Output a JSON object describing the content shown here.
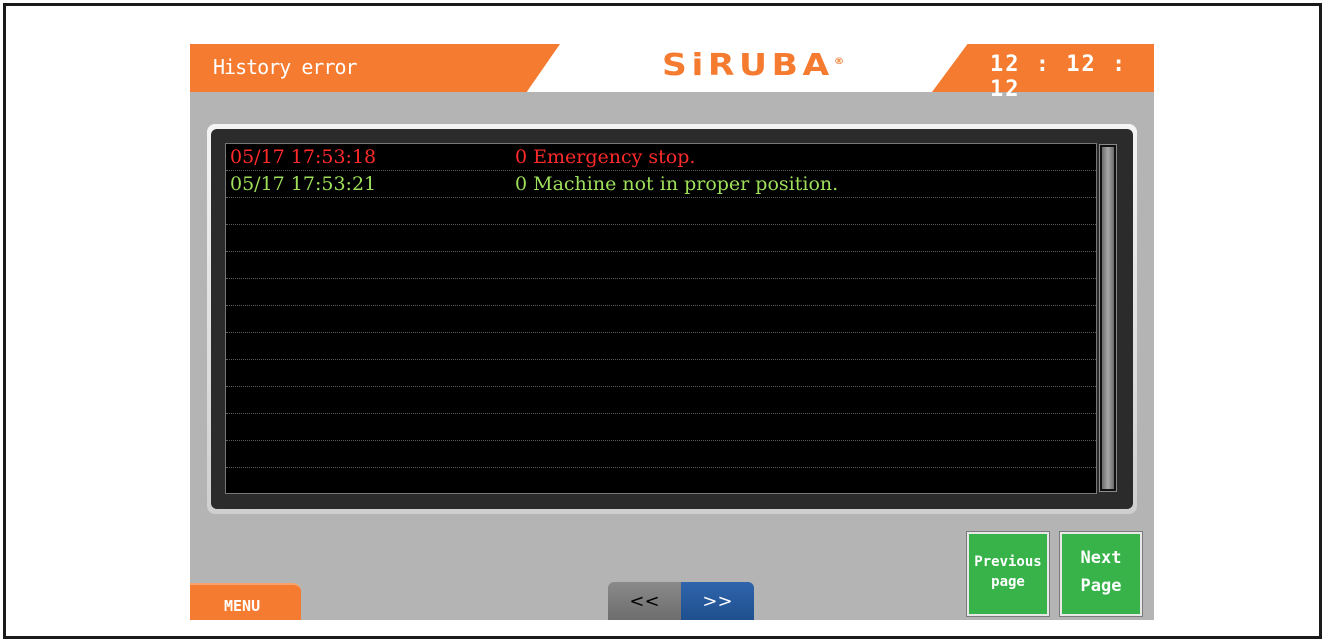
{
  "header": {
    "title": "History error",
    "brand": "SiRUBA",
    "brand_mark": "®",
    "clock": "12 : 12 : 12"
  },
  "log": {
    "entries": [
      {
        "timestamp": "05/17 17:53:18",
        "message": "0 Emergency stop.",
        "color": "#ff2a2a"
      },
      {
        "timestamp": "05/17 17:53:21",
        "message": "0 Machine not in proper position.",
        "color": "#9ee05a"
      }
    ]
  },
  "controls": {
    "menu_label": "MENU",
    "nav_prev_label": "<<",
    "nav_next_label": ">>",
    "previous_page_line1": "Previous",
    "previous_page_line2": "page",
    "next_page_line1": "Next",
    "next_page_line2": "Page"
  },
  "colors": {
    "accent": "#f47b30",
    "panel": "#b4b4b4",
    "button_green": "#37b34a",
    "nav_blue": "#2f65ac"
  }
}
